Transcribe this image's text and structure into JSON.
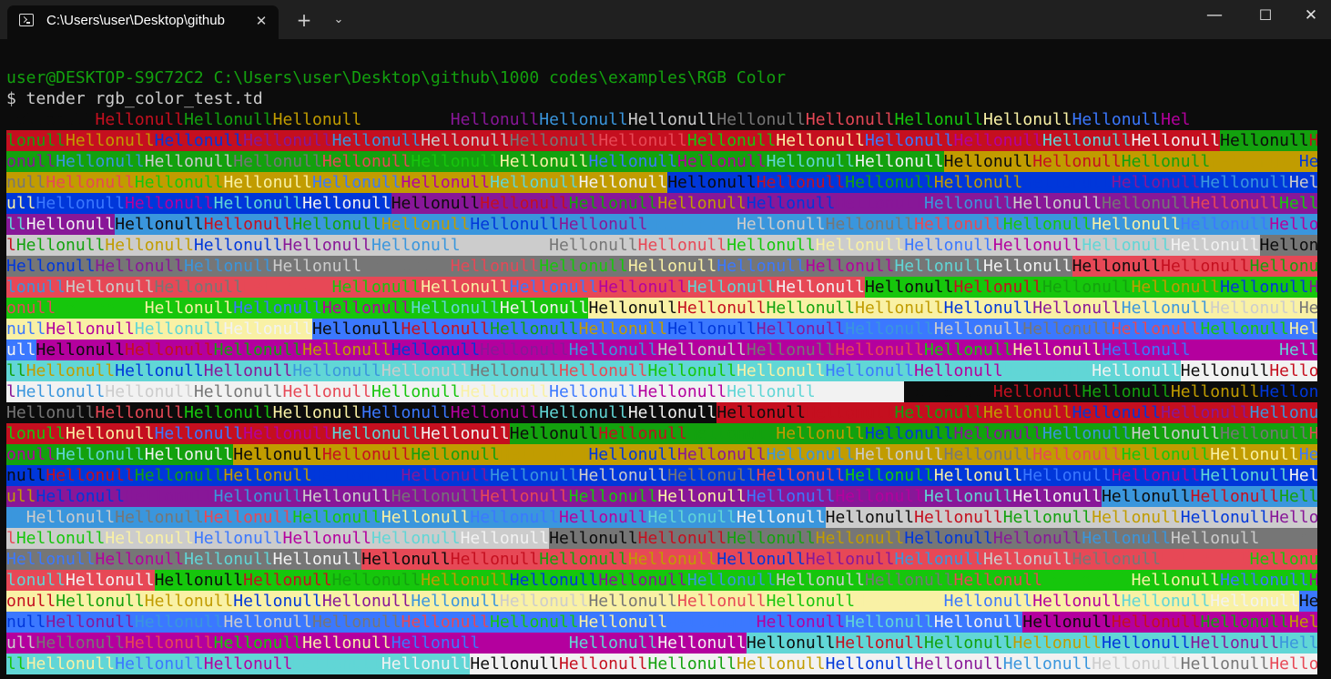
{
  "window": {
    "tab_title": "C:\\Users\\user\\Desktop\\github",
    "tab_icon": "terminal-icon",
    "close_tab_glyph": "✕",
    "new_tab_glyph": "+",
    "dropdown_glyph": "⌄",
    "minimize_glyph": "—",
    "maximize_glyph": "☐",
    "close_glyph": "✕"
  },
  "terminal": {
    "prompt_line": "user@DESKTOP-S9C72C2 C:\\Users\\user\\Desktop\\github\\1000 codes\\examples\\RGB Color",
    "command_line": "$ tender rgb_color_test.td",
    "output_word": "Hellonull",
    "palette": [
      "#0c0c0c",
      "#c50f1f",
      "#13a10e",
      "#c19c00",
      "#0037da",
      "#881798",
      "#3a96dd",
      "#cccccc",
      "#767676",
      "#e74856",
      "#16c60c",
      "#f9f1a5",
      "#3b78ff",
      "#b4009e",
      "#61d6d6",
      "#f2f2f2"
    ],
    "output_rows": 27,
    "first_row_text": "HellonullHellonullHellonullHellonull         HellonullHellonullHellonullHellonullHellonullHellonullHellonullHellonullHel"
  }
}
